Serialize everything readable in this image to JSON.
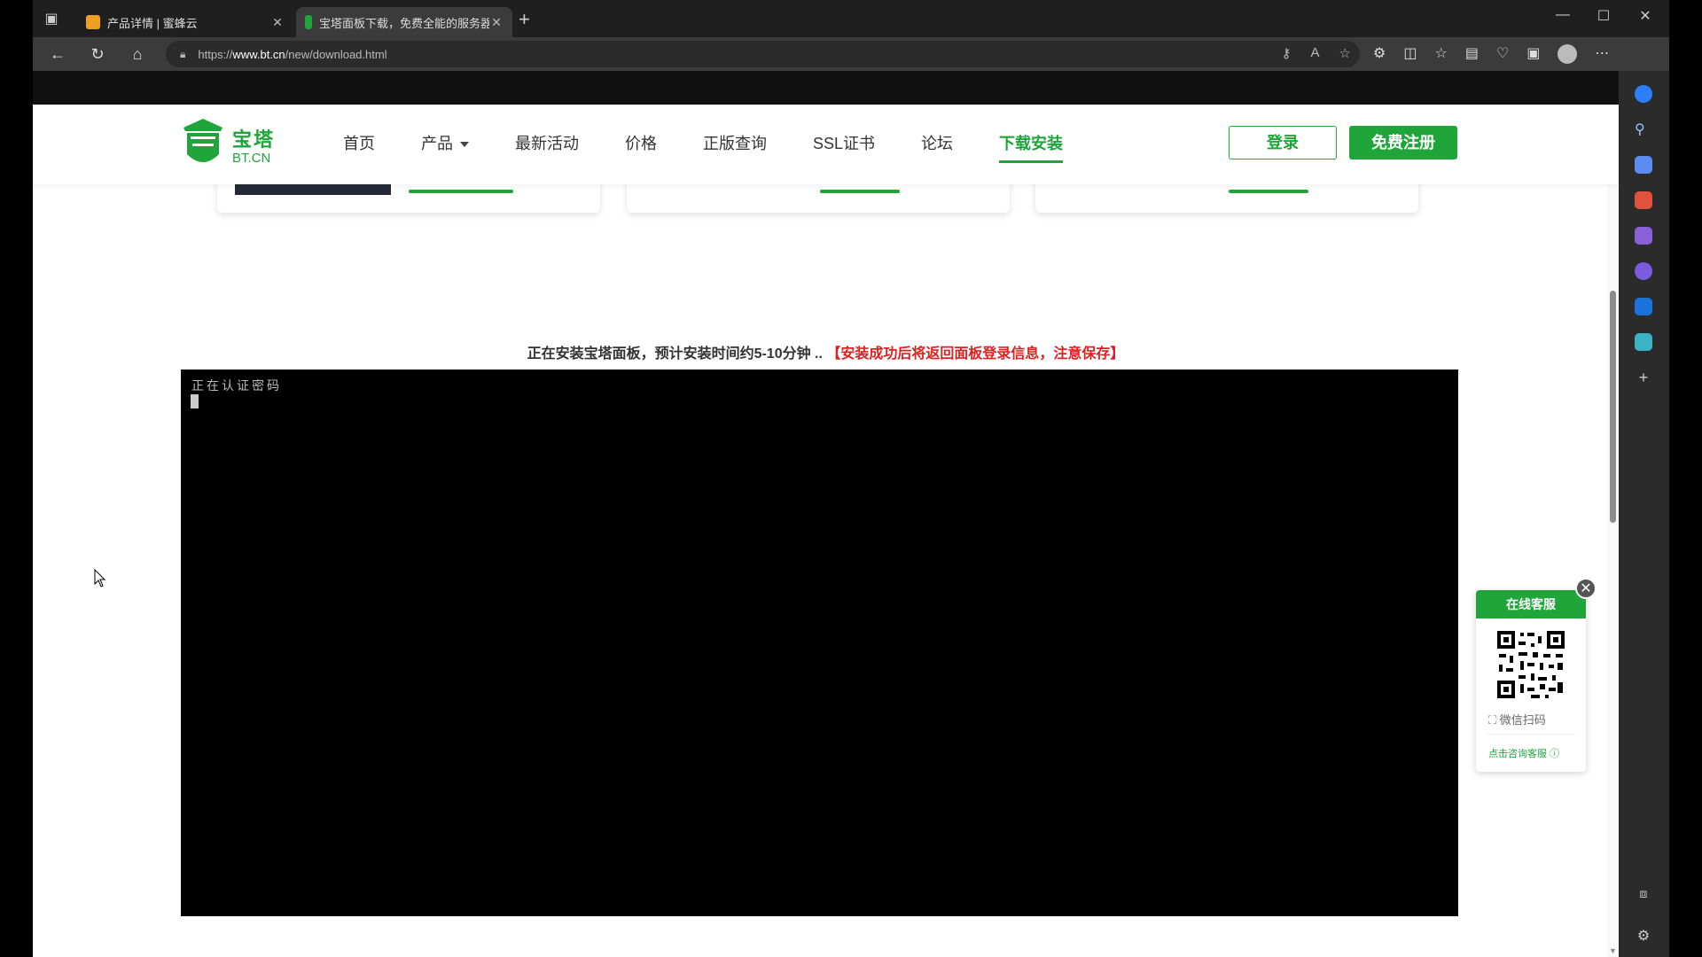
{
  "browser": {
    "tabs": [
      {
        "label": "产品详情 | 蜜蜂云",
        "active": false
      },
      {
        "label": "宝塔面板下载，免费全能的服务器",
        "active": true
      }
    ],
    "new_tab": "+",
    "url_prefix": "https://",
    "url_host": "www.bt.cn",
    "url_path": "/new/download.html"
  },
  "site": {
    "logo_cn": "宝塔",
    "logo_en": "BT.CN",
    "brand_color": "#20a53a",
    "nav": [
      {
        "label": "首页"
      },
      {
        "label": "产品"
      },
      {
        "label": "最新活动"
      },
      {
        "label": "价格"
      },
      {
        "label": "正版查询"
      },
      {
        "label": "SSL证书"
      },
      {
        "label": "论坛"
      },
      {
        "label": "下载安装"
      }
    ],
    "login_label": "登录",
    "register_label": "免费注册"
  },
  "install": {
    "status_text": "正在安装宝塔面板，预计安装时间约5-10分钟 ..",
    "status_warning": "【安装成功后将返回面板登录信息，注意保存】",
    "terminal_line": "正在认证密码"
  },
  "chat_widget": {
    "title": "在线客服",
    "scan_label": "微信扫码",
    "consult_label": "点击咨询客服"
  }
}
